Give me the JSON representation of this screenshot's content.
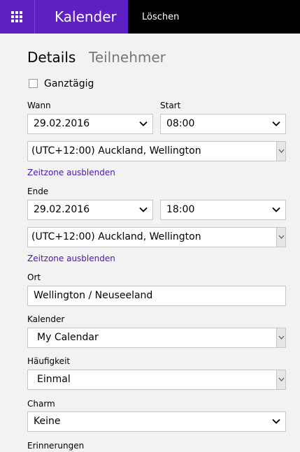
{
  "header": {
    "app_title": "Kalender",
    "delete_label": "Löschen",
    "accent_color": "#5f1fc1"
  },
  "tabs": {
    "details": "Details",
    "participants": "Teilnehmer"
  },
  "allday": {
    "label": "Ganztägig",
    "checked": false
  },
  "when": {
    "label": "Wann",
    "date": "29.02.2016",
    "start_label": "Start",
    "start_time": "08:00",
    "timezone": "(UTC+12:00) Auckland, Wellington",
    "hide_timezone": "Zeitzone ausblenden"
  },
  "end": {
    "label": "Ende",
    "date": "29.02.2016",
    "time": "18:00",
    "timezone": "(UTC+12:00) Auckland, Wellington",
    "hide_timezone": "Zeitzone ausblenden"
  },
  "location": {
    "label": "Ort",
    "value": "Wellington / Neuseeland"
  },
  "calendar": {
    "label": "Kalender",
    "value": "My Calendar"
  },
  "frequency": {
    "label": "Häufigkeit",
    "value": "Einmal"
  },
  "charm": {
    "label": "Charm",
    "value": "Keine"
  },
  "reminders": {
    "label": "Erinnerungen"
  }
}
